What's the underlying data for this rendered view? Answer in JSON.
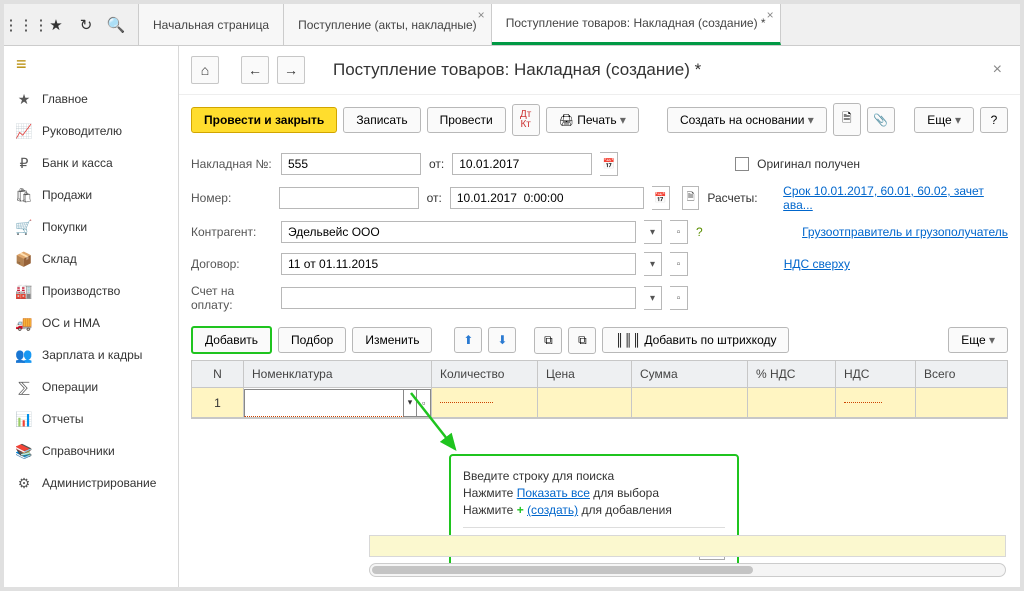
{
  "tabs": {
    "home": "Начальная страница",
    "receipts": "Поступление (акты, накладные)",
    "current": "Поступление товаров: Накладная (создание) *"
  },
  "sidebar": {
    "items": [
      {
        "icon": "★",
        "label": "Главное"
      },
      {
        "icon": "📈",
        "label": "Руководителю"
      },
      {
        "icon": "₽",
        "label": "Банк и касса"
      },
      {
        "icon": "🛍",
        "label": "Продажи"
      },
      {
        "icon": "🛒",
        "label": "Покупки"
      },
      {
        "icon": "📦",
        "label": "Склад"
      },
      {
        "icon": "🏭",
        "label": "Производство"
      },
      {
        "icon": "🚚",
        "label": "ОС и НМА"
      },
      {
        "icon": "👥",
        "label": "Зарплата и кадры"
      },
      {
        "icon": "⅀",
        "label": "Операции"
      },
      {
        "icon": "📊",
        "label": "Отчеты"
      },
      {
        "icon": "📚",
        "label": "Справочники"
      },
      {
        "icon": "⚙",
        "label": "Администрирование"
      }
    ]
  },
  "page": {
    "title": "Поступление товаров: Накладная (создание) *",
    "toolbar": {
      "post_close": "Провести и закрыть",
      "save": "Записать",
      "post": "Провести",
      "print": "Печать",
      "create_based": "Создать на основании",
      "more": "Еще"
    },
    "form": {
      "invoice_no_label": "Накладная №:",
      "invoice_no": "555",
      "from_label": "от:",
      "invoice_date": "10.01.2017",
      "original_received": "Оригинал получен",
      "number_label": "Номер:",
      "number_date": "10.01.2017  0:00:00",
      "settlements_label": "Расчеты:",
      "settlements_link": "Срок 10.01.2017, 60.01, 60.02, зачет ава...",
      "counterparty_label": "Контрагент:",
      "counterparty": "Эдельвейс ООО",
      "shipper_link": "Грузоотправитель и грузополучатель",
      "contract_label": "Договор:",
      "contract": "11 от 01.11.2015",
      "vat_link": "НДС сверху",
      "payment_acc_label": "Счет на оплату:"
    },
    "tbtoolbar": {
      "add": "Добавить",
      "pick": "Подбор",
      "edit": "Изменить",
      "barcode": "Добавить по штрихкоду",
      "more": "Еще"
    },
    "grid": {
      "headers": {
        "n": "N",
        "nom": "Номенклатура",
        "qty": "Количество",
        "price": "Цена",
        "sum": "Сумма",
        "vatp": "% НДС",
        "vat": "НДС",
        "tot": "Всего"
      },
      "row1": {
        "n": "1"
      }
    },
    "popup": {
      "line1": "Введите строку для поиска",
      "line2a": "Нажмите ",
      "line2b": "Показать все",
      "line2c": " для выбора",
      "line3a": "Нажмите ",
      "line3b": "(создать)",
      "line3c": " для добавления",
      "show_all": "Показать все"
    }
  }
}
